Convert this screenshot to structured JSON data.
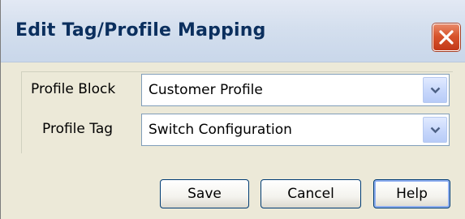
{
  "dialog": {
    "title": "Edit Tag/Profile Mapping"
  },
  "fields": {
    "profile_block": {
      "label": "Profile Block",
      "value": "Customer Profile"
    },
    "profile_tag": {
      "label": "Profile Tag",
      "value": "Switch Configuration"
    }
  },
  "buttons": {
    "save": "Save",
    "cancel": "Cancel",
    "help": "Help"
  },
  "icons": {
    "close": "close-icon",
    "dropdown": "chevron-down-icon"
  },
  "colors": {
    "title_text": "#0b2f5e",
    "close_button": "#d8542c",
    "dialog_background": "#ece9d8",
    "field_border": "#7f9db9"
  }
}
